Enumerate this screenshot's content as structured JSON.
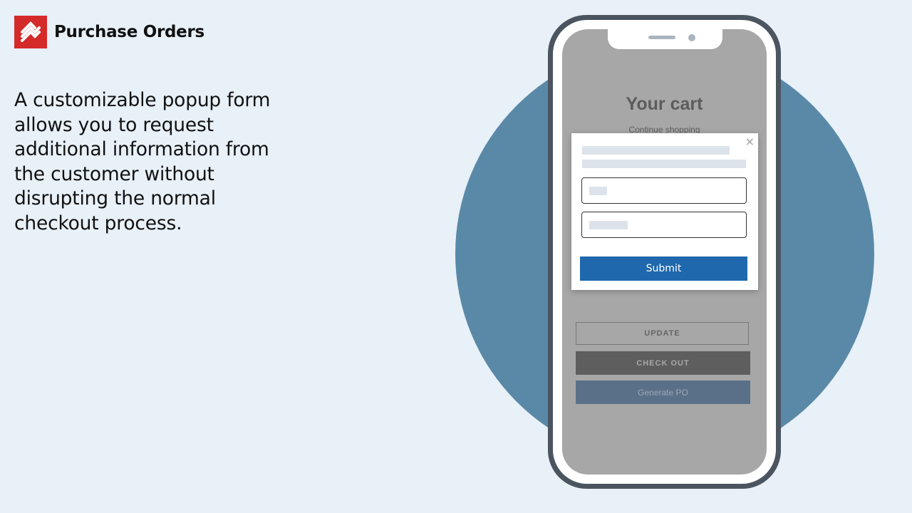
{
  "header": {
    "title": "Purchase Orders",
    "logo_icon": "stacked-s-logo-icon",
    "brand_color": "#d42a2a"
  },
  "description": "A customizable popup form allows you to request additional information from the customer without disrupting the normal checkout process.",
  "phone": {
    "cart": {
      "title": "Your cart",
      "continue_link": "Continue shopping",
      "update_label": "UPDATE",
      "checkout_label": "CHECK OUT",
      "generate_po_label": "Generate PO"
    },
    "popup": {
      "close_icon": "close-icon",
      "close_glyph": "×",
      "submit_label": "Submit",
      "submit_color": "#1f68ad"
    }
  },
  "colors": {
    "background": "#e8f0f8",
    "circle": "#5a89a8",
    "phone_frame": "#4a5560"
  }
}
